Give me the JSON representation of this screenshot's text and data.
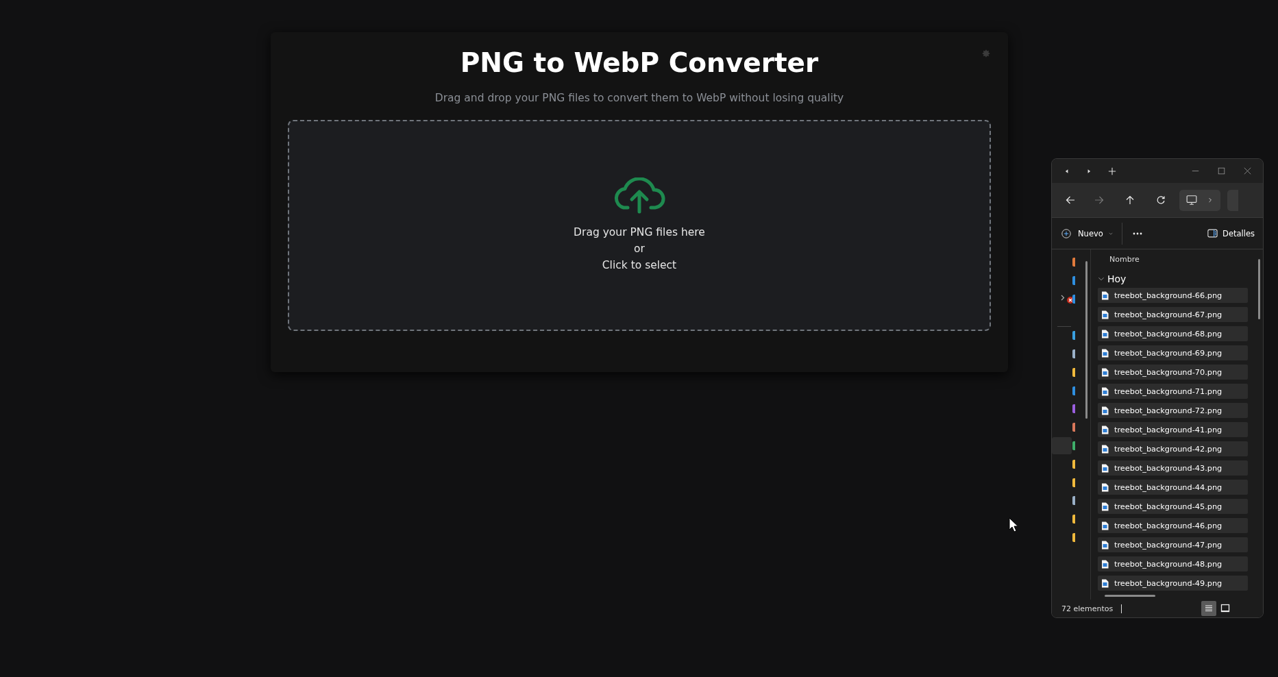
{
  "converter": {
    "title": "PNG to WebP Converter",
    "subtitle": "Drag and drop your PNG files to convert them to WebP without losing quality",
    "dropzone": {
      "line1": "Drag your PNG files here",
      "line2": "or",
      "line3": "Click to select"
    }
  },
  "explorer": {
    "new_button": "Nuevo",
    "details_button": "Detalles",
    "column": "Nombre",
    "group": "Hoy",
    "files": [
      "treebot_background-66.png",
      "treebot_background-67.png",
      "treebot_background-68.png",
      "treebot_background-69.png",
      "treebot_background-70.png",
      "treebot_background-71.png",
      "treebot_background-72.png",
      "treebot_background-41.png",
      "treebot_background-42.png",
      "treebot_background-43.png",
      "treebot_background-44.png",
      "treebot_background-45.png",
      "treebot_background-46.png",
      "treebot_background-47.png",
      "treebot_background-48.png",
      "treebot_background-49.png"
    ],
    "status": "72 elementos",
    "view_modes": [
      {
        "kind": "details",
        "selected": true
      },
      {
        "kind": "tiles",
        "selected": false
      }
    ]
  }
}
